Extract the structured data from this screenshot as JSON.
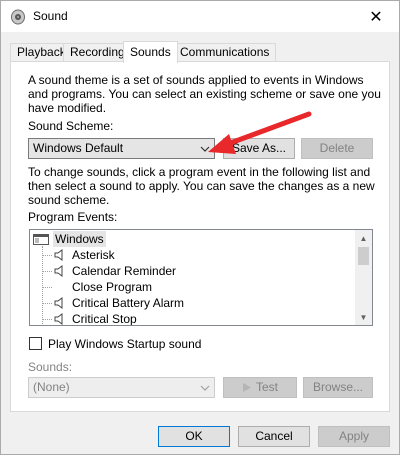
{
  "window": {
    "title": "Sound",
    "close_glyph": "✕"
  },
  "tabs": [
    {
      "label": "Playback"
    },
    {
      "label": "Recording"
    },
    {
      "label": "Sounds",
      "active": true
    },
    {
      "label": "Communications"
    }
  ],
  "sounds": {
    "intro_lines": [
      "A sound theme is a set of sounds applied to events in Windows",
      "and programs.  You can select an existing scheme or save one you",
      "have modified."
    ],
    "scheme_label": "Sound Scheme:",
    "scheme_value": "Windows Default",
    "save_as_label": "Save As...",
    "delete_label": "Delete",
    "change_lines": [
      "To change sounds, click a program event in the following list and",
      "then select a sound to apply.  You can save the changes as a new",
      "sound scheme."
    ],
    "events_label": "Program Events:",
    "events": [
      {
        "label": "Windows",
        "kind": "group"
      },
      {
        "label": "Asterisk",
        "has_sound": true
      },
      {
        "label": "Calendar Reminder",
        "has_sound": true
      },
      {
        "label": "Close Program",
        "has_sound": false
      },
      {
        "label": "Critical Battery Alarm",
        "has_sound": true
      },
      {
        "label": "Critical Stop",
        "has_sound": true
      }
    ],
    "startup_label": "Play Windows Startup sound",
    "startup_checked": false,
    "sounds_label": "Sounds:",
    "sounds_value": "(None)",
    "test_label": "Test",
    "browse_label": "Browse..."
  },
  "footer": {
    "ok_label": "OK",
    "cancel_label": "Cancel",
    "apply_label": "Apply"
  },
  "colors": {
    "annotation_arrow": "#e8282b",
    "focus_border": "#0078d7"
  }
}
